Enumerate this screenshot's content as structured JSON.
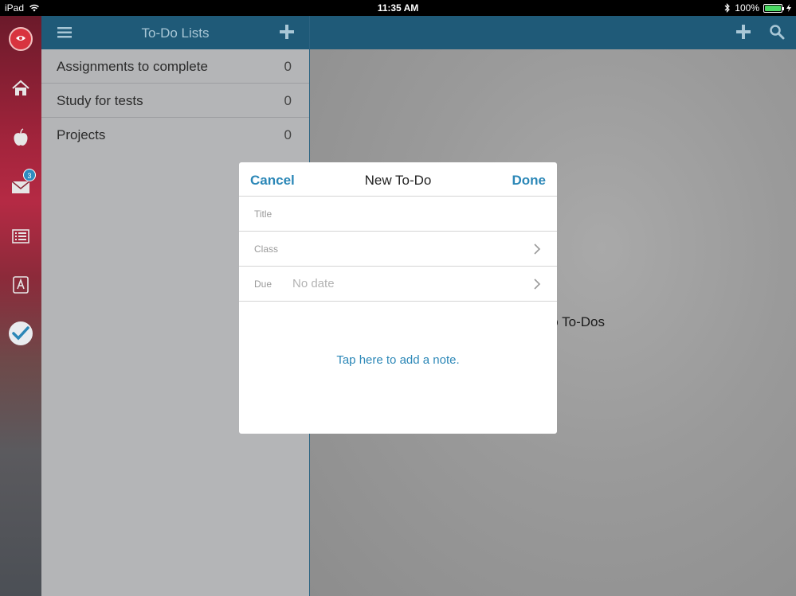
{
  "status_bar": {
    "device": "iPad",
    "time": "11:35 AM",
    "battery": "100%",
    "battery_level": 1.0
  },
  "rail": {
    "mail_badge": "3"
  },
  "list_pane": {
    "title": "To-Do Lists",
    "rows": [
      {
        "label": "Assignments to complete",
        "count": "0"
      },
      {
        "label": "Study for tests",
        "count": "0"
      },
      {
        "label": "Projects",
        "count": "0"
      }
    ]
  },
  "main_pane": {
    "empty_text": "No To-Dos"
  },
  "modal": {
    "cancel_label": "Cancel",
    "title": "New To-Do",
    "done_label": "Done",
    "fields": {
      "title_label": "Title",
      "class_label": "Class",
      "due_label": "Due",
      "due_value": "No date"
    },
    "note_prompt": "Tap here to add a note."
  },
  "colors": {
    "header_bg": "#1f5a78",
    "accent": "#2b87b7"
  }
}
